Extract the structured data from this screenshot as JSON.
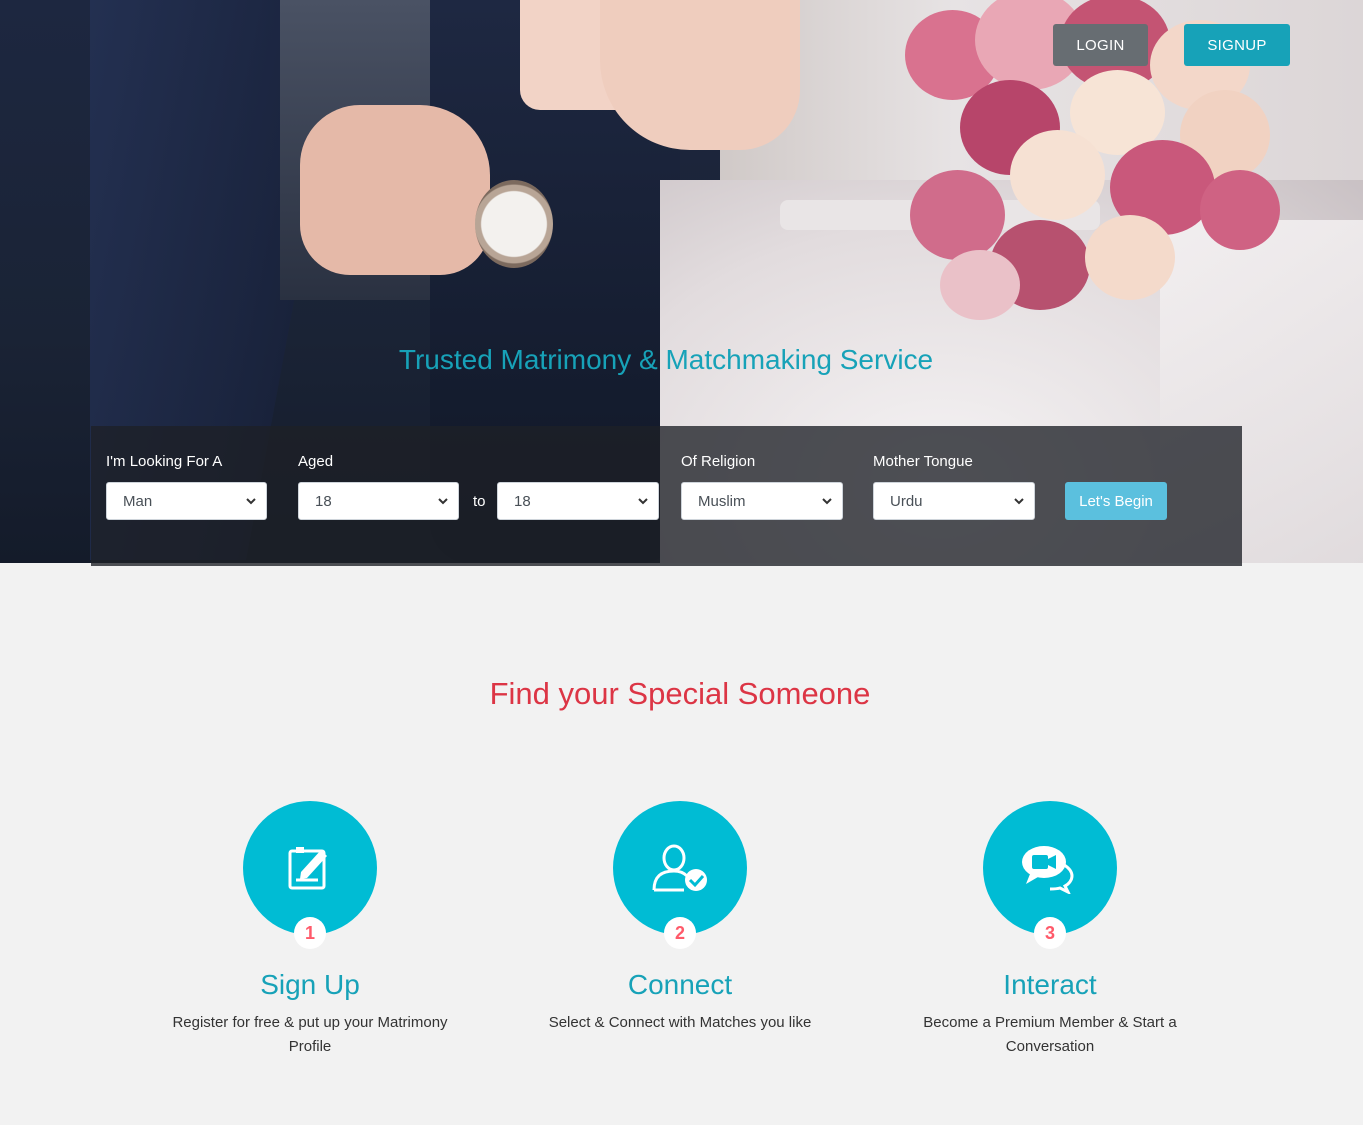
{
  "header": {
    "login_label": "LOGIN",
    "signup_label": "SIGNUP"
  },
  "hero": {
    "tagline": "Trusted Matrimony & Matchmaking Service"
  },
  "search": {
    "looking_for": {
      "label": "I'm Looking For A",
      "value": "Man"
    },
    "aged": {
      "label": "Aged",
      "from_value": "18",
      "to_label": "to",
      "to_value": "18"
    },
    "religion": {
      "label": "Of Religion",
      "value": "Muslim"
    },
    "mother_tongue": {
      "label": "Mother Tongue",
      "value": "Urdu"
    },
    "submit_label": "Let's Begin"
  },
  "steps_section": {
    "title": "Find your Special Someone",
    "steps": [
      {
        "number": "1",
        "icon": "edit-form-icon",
        "title": "Sign Up",
        "text": "Register for free & put up your Matrimony Profile"
      },
      {
        "number": "2",
        "icon": "user-check-icon",
        "title": "Connect",
        "text": "Select & Connect with Matches you like"
      },
      {
        "number": "3",
        "icon": "video-chat-icon",
        "title": "Interact",
        "text": "Become a Premium Member & Start a Conversation"
      }
    ]
  },
  "colors": {
    "accent": "#17a2b8",
    "title_red": "#dc3545",
    "circle": "#00bcd4",
    "number_red": "#ff5a6a"
  }
}
